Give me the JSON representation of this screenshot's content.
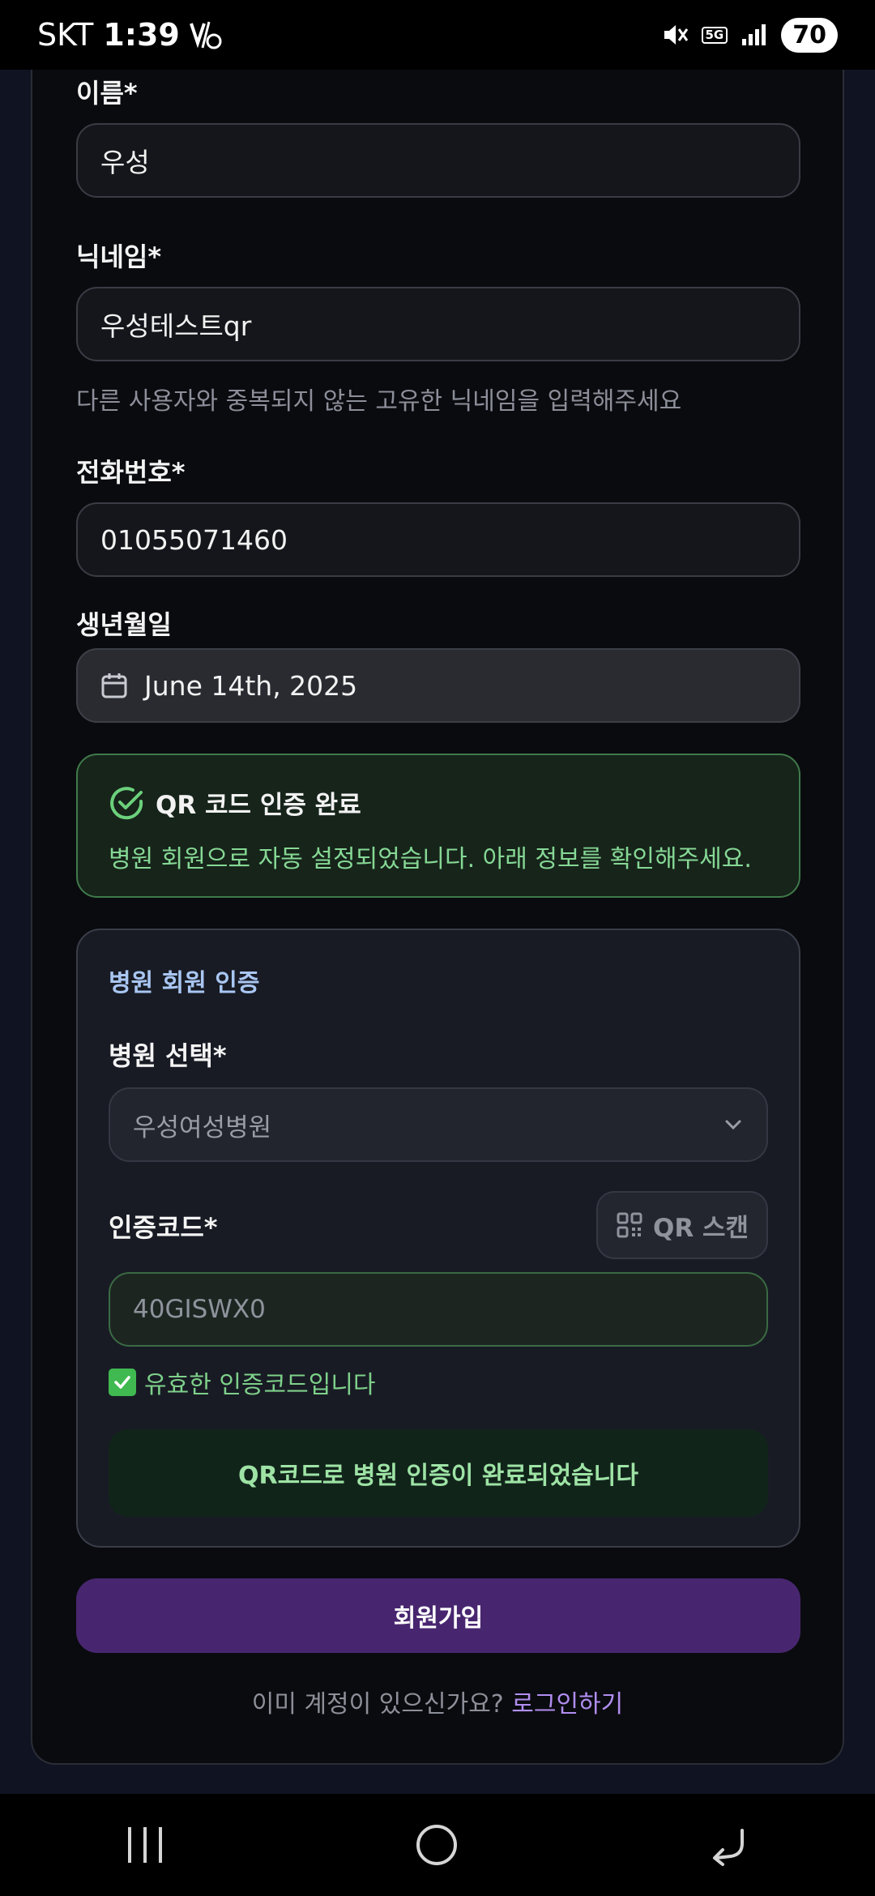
{
  "status_bar": {
    "carrier": "SKT",
    "time": "1:39",
    "network": "5G",
    "battery": "70"
  },
  "form": {
    "name": {
      "label": "이름*",
      "value": "우성"
    },
    "nickname": {
      "label": "닉네임*",
      "value": "우성테스트qr",
      "helper": "다른 사용자와 중복되지 않는 고유한 닉네임을 입력해주세요"
    },
    "phone": {
      "label": "전화번호*",
      "value": "01055071460"
    },
    "birthdate": {
      "label": "생년월일",
      "value": "June 14th, 2025"
    }
  },
  "qr_status": {
    "title": "QR 코드 인증 완료",
    "description": "병원 회원으로 자동 설정되었습니다. 아래 정보를 확인해주세요."
  },
  "hospital_auth": {
    "title": "병원 회원 인증",
    "hospital_label": "병원 선택*",
    "hospital_selected": "우성여성병원",
    "code_label": "인증코드*",
    "scan_button": "QR 스캔",
    "code_value": "40GISWX0",
    "valid_message": "유효한 인증코드입니다",
    "complete_message": "QR코드로 병원 인증이 완료되었습니다"
  },
  "signup_button": "회원가입",
  "login_prompt": {
    "text": "이미 계정이 있으신가요?",
    "link": "로그인하기"
  },
  "colors": {
    "accent_purple": "#48266f",
    "success_green": "#7ed08a",
    "hospital_title_blue": "#a9c6f2"
  }
}
